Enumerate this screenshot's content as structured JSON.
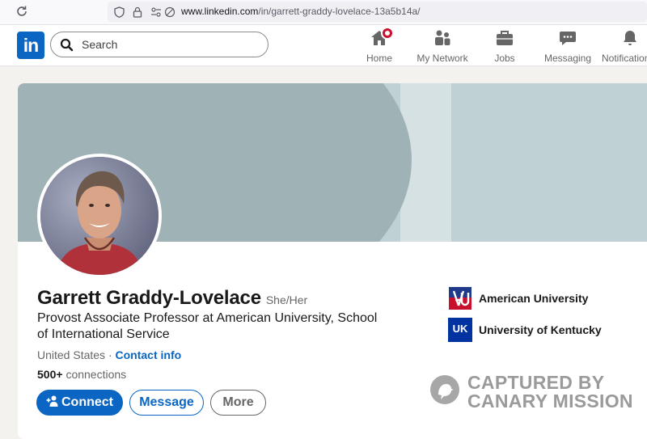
{
  "browser": {
    "url_domain": "www.linkedin.com",
    "url_path": "/in/garrett-graddy-lovelace-13a5b14a/"
  },
  "nav": {
    "logo_text": "in",
    "search_placeholder": "Search",
    "items": [
      {
        "label": "Home",
        "icon": "home-icon",
        "has_badge": true
      },
      {
        "label": "My Network",
        "icon": "network-icon"
      },
      {
        "label": "Jobs",
        "icon": "briefcase-icon"
      },
      {
        "label": "Messaging",
        "icon": "messaging-icon"
      },
      {
        "label": "Notifications",
        "icon": "bell-icon"
      }
    ]
  },
  "profile": {
    "name": "Garrett Graddy-Lovelace",
    "pronouns": "She/Her",
    "headline": "Provost Associate Professor at American University, School of International Service",
    "location": "United States",
    "separator": "·",
    "contact_info": "Contact info",
    "connections_count": "500+",
    "connections_label": "connections",
    "buttons": {
      "connect": "Connect",
      "message": "Message",
      "more": "More"
    },
    "education": [
      {
        "name": "American University"
      },
      {
        "name": "University of Kentucky",
        "logo_text": "UK"
      }
    ]
  },
  "colors": {
    "brand": "#0a66c2",
    "cover_dark": "#9fb3b7",
    "cover_light": "#bfd1d5",
    "badge": "#cb112d"
  },
  "watermark": {
    "line1": "CAPTURED BY",
    "line2": "CANARY MISSION"
  }
}
